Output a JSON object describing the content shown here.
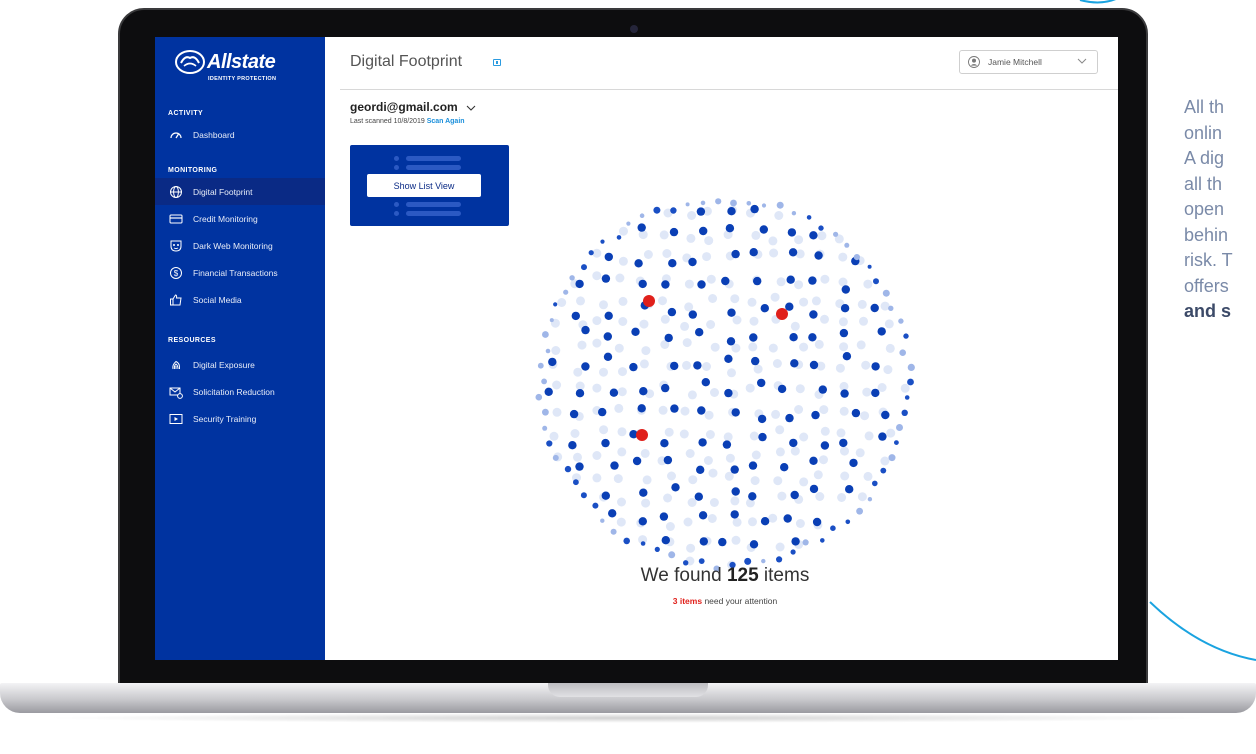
{
  "brand": {
    "name": "Allstate",
    "subtitle": "IDENTITY PROTECTION"
  },
  "sidebar": {
    "sections": [
      {
        "heading": "ACTIVITY",
        "items": [
          {
            "label": "Dashboard",
            "icon": "speedometer-icon"
          }
        ]
      },
      {
        "heading": "MONITORING",
        "items": [
          {
            "label": "Digital Footprint",
            "icon": "globe-icon",
            "active": true
          },
          {
            "label": "Credit Monitoring",
            "icon": "credit-card-icon"
          },
          {
            "label": "Dark Web Monitoring",
            "icon": "mask-icon"
          },
          {
            "label": "Financial Transactions",
            "icon": "dollar-icon"
          },
          {
            "label": "Social Media",
            "icon": "thumbs-up-icon"
          }
        ]
      },
      {
        "heading": "RESOURCES",
        "items": [
          {
            "label": "Digital Exposure",
            "icon": "fingerprint-icon"
          },
          {
            "label": "Solicitation Reduction",
            "icon": "envelope-block-icon"
          },
          {
            "label": "Security Training",
            "icon": "play-video-icon"
          }
        ]
      }
    ]
  },
  "header": {
    "title": "Digital Footprint",
    "user_name": "Jamie Mitchell"
  },
  "account": {
    "email": "geordi@gmail.com",
    "last_scanned": "Last scanned 10/8/2019",
    "scan_again": "Scan Again"
  },
  "list_view_button": "Show List View",
  "results": {
    "prefix": "We found",
    "count": "125",
    "suffix": "items",
    "attention_count": "3 items",
    "attention_text": "need your attention"
  },
  "side_text": {
    "lines": [
      "All th",
      "onlin",
      "A dig",
      "all th",
      "open",
      "behin",
      "risk. T",
      "offers"
    ],
    "bold_line": "and s"
  },
  "colors": {
    "sidebar": "#0033a0",
    "accent": "#1a8fdb",
    "alert": "#e0201b",
    "bubble": "#0a3fb5"
  }
}
